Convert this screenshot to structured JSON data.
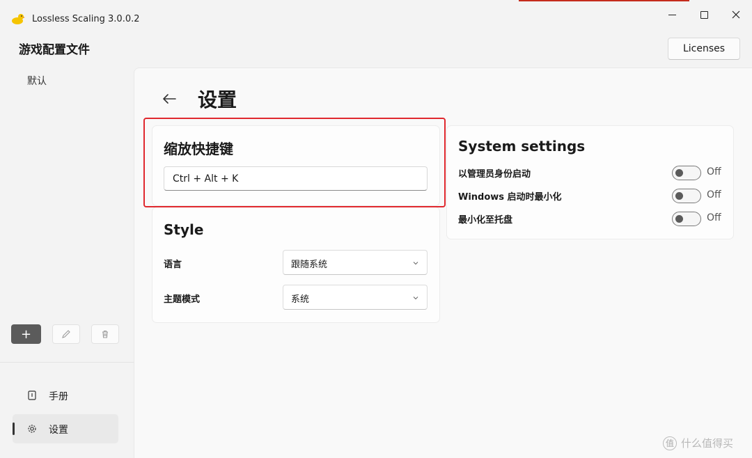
{
  "window": {
    "title": "Lossless Scaling 3.0.0.2",
    "accent_color": "#c42b1c"
  },
  "sidebar": {
    "heading": "游戏配置文件",
    "profiles": [
      {
        "label": "默认"
      }
    ],
    "buttons": {
      "add_label": "+"
    },
    "nav": [
      {
        "label": "手册",
        "icon": "book-icon"
      },
      {
        "label": "设置",
        "icon": "gear-icon"
      }
    ]
  },
  "header": {
    "licenses_label": "Licenses"
  },
  "page": {
    "title": "设置",
    "highlight_color": "#e0282e"
  },
  "hotkey_card": {
    "title": "缩放快捷键",
    "value": "Ctrl + Alt + K"
  },
  "style_card": {
    "title": "Style",
    "language_label": "语言",
    "language_value": "跟随系统",
    "theme_label": "主题模式",
    "theme_value": "系统"
  },
  "system_card": {
    "title": "System settings",
    "items": [
      {
        "label": "以管理员身份启动",
        "state": "Off"
      },
      {
        "label": "Windows 启动时最小化",
        "state": "Off"
      },
      {
        "label": "最小化至托盘",
        "state": "Off"
      }
    ]
  },
  "watermark": {
    "badge": "值",
    "text": "什么值得买"
  }
}
